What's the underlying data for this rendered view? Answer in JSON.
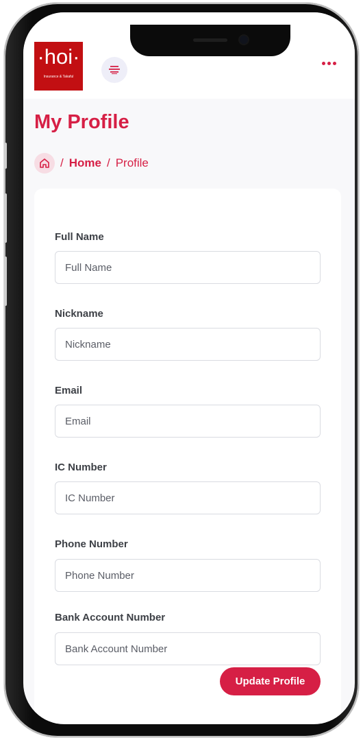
{
  "app": {
    "logo_text": "·hoi·",
    "logo_subtitle": "Insurance & Takaful"
  },
  "header": {
    "menu_icon": "hamburger-icon",
    "more_icon": "more-horizontal-icon"
  },
  "page": {
    "title": "My Profile"
  },
  "breadcrumb": {
    "separator": "/",
    "home": "Home",
    "current": "Profile",
    "icon": "home-icon"
  },
  "form": {
    "fields": [
      {
        "label": "Full Name",
        "placeholder": "Full Name",
        "value": ""
      },
      {
        "label": "Nickname",
        "placeholder": "Nickname",
        "value": ""
      },
      {
        "label": "Email",
        "placeholder": "Email",
        "value": ""
      },
      {
        "label": "IC Number",
        "placeholder": "IC Number",
        "value": ""
      },
      {
        "label": "Phone Number",
        "placeholder": "Phone Number",
        "value": ""
      },
      {
        "label": "Bank Account Number",
        "placeholder": "Bank Account Number",
        "value": ""
      }
    ],
    "submit_label": "Update Profile"
  },
  "colors": {
    "accent": "#d61f45",
    "logo_bg": "#c20f12",
    "menu_bg": "#eeeef8"
  }
}
